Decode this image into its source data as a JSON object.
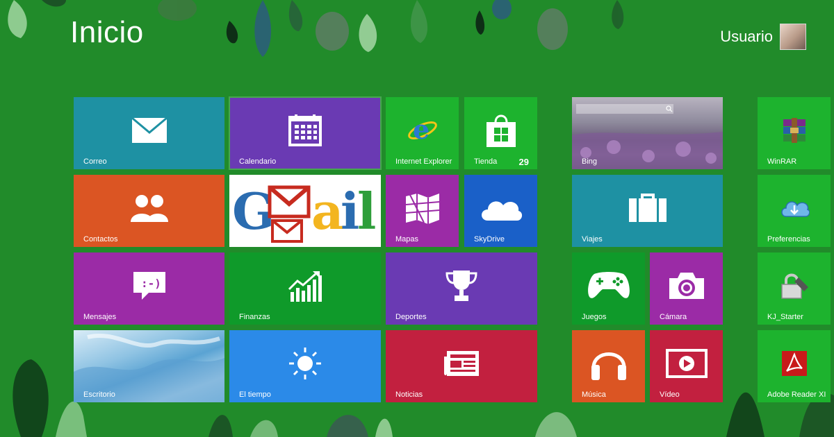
{
  "header": {
    "title": "Inicio",
    "user_name": "Usuario"
  },
  "tiles": {
    "correo": {
      "label": "Correo",
      "color": "#1e91a3",
      "icon": "mail-icon"
    },
    "calendario": {
      "label": "Calendario",
      "color": "#6a3ab3",
      "icon": "calendar-icon"
    },
    "internet_explorer": {
      "label": "Internet Explorer",
      "color": "#1db32e",
      "icon": "internet-explorer-icon"
    },
    "tienda": {
      "label": "Tienda",
      "badge": "29",
      "color": "#1db32e",
      "icon": "store-icon"
    },
    "bing": {
      "label": "Bing",
      "icon": "bing-search-image"
    },
    "winrar": {
      "label": "WinRAR",
      "color": "#1db32e",
      "icon": "winrar-icon"
    },
    "contactos": {
      "label": "Contactos",
      "color": "#db5523",
      "icon": "people-icon"
    },
    "gmail": {
      "logo_text": "GMail",
      "icon": "gmail-logo"
    },
    "mapas": {
      "label": "Mapas",
      "color": "#9b2ba6",
      "icon": "maps-icon"
    },
    "skydrive": {
      "label": "SkyDrive",
      "color": "#1a60c8",
      "icon": "cloud-icon"
    },
    "viajes": {
      "label": "Viajes",
      "color": "#1e91a3",
      "icon": "suitcase-icon"
    },
    "preferencias": {
      "label": "Preferencias",
      "color": "#1db32e",
      "icon": "cloud-sync-icon"
    },
    "mensajes": {
      "label": "Mensajes",
      "color": "#9b2ba6",
      "icon": "message-icon"
    },
    "finanzas": {
      "label": "Finanzas",
      "color": "#0f9a2a",
      "icon": "finance-chart-icon"
    },
    "deportes": {
      "label": "Deportes",
      "color": "#6a3ab3",
      "icon": "trophy-icon"
    },
    "juegos": {
      "label": "Juegos",
      "color": "#0f9a2a",
      "icon": "xbox-controller-icon"
    },
    "camara": {
      "label": "Cámara",
      "color": "#9b2ba6",
      "icon": "camera-icon"
    },
    "kj_starter": {
      "label": "KJ_Starter",
      "color": "#1db32e",
      "icon": "lock-icon"
    },
    "escritorio": {
      "label": "Escritorio",
      "icon": "desktop-wallpaper"
    },
    "el_tiempo": {
      "label": "El tiempo",
      "color": "#2b8ae8",
      "icon": "sun-icon"
    },
    "noticias": {
      "label": "Noticias",
      "color": "#c2203f",
      "icon": "newspaper-icon"
    },
    "musica": {
      "label": "Música",
      "color": "#db5523",
      "icon": "headphones-icon"
    },
    "video": {
      "label": "Vídeo",
      "color": "#c2203f",
      "icon": "play-icon"
    },
    "adobe_reader": {
      "label": "Adobe Reader XI",
      "color": "#1db32e",
      "icon": "adobe-reader-icon"
    }
  }
}
